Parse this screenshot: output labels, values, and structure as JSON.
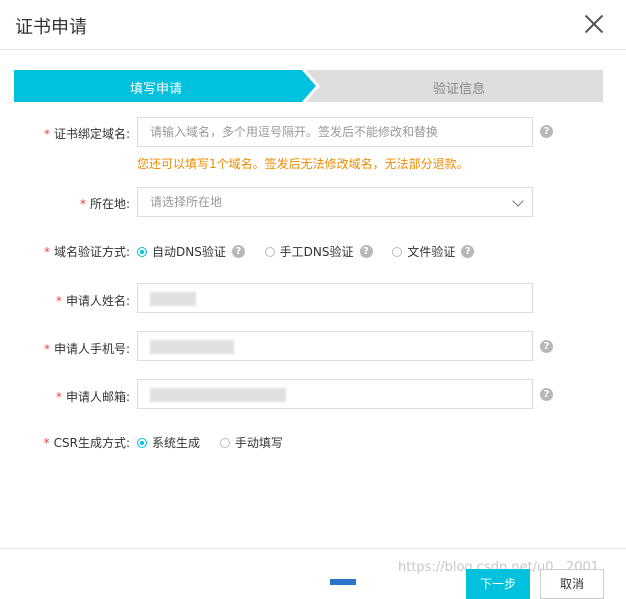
{
  "dialog": {
    "title": "证书申请",
    "close_icon": "close-icon"
  },
  "steps": [
    {
      "label": "填写申请",
      "active": true
    },
    {
      "label": "验证信息",
      "active": false
    }
  ],
  "form": {
    "required_mark": "*",
    "domain": {
      "label": "证书绑定域名:",
      "placeholder": "请输入域名，多个用逗号隔开。签发后不能修改和替换",
      "hint": "您还可以填写1个域名。签发后无法修改域名，无法部分退款。"
    },
    "location": {
      "label": "所在地:",
      "placeholder": "请选择所在地"
    },
    "verify_method": {
      "label": "域名验证方式:",
      "options": [
        {
          "label": "自动DNS验证",
          "checked": true
        },
        {
          "label": "手工DNS验证",
          "checked": false
        },
        {
          "label": "文件验证",
          "checked": false
        }
      ]
    },
    "applicant_name": {
      "label": "申请人姓名:"
    },
    "applicant_phone": {
      "label": "申请人手机号:"
    },
    "applicant_email": {
      "label": "申请人邮箱:"
    },
    "csr": {
      "label": "CSR生成方式:",
      "options": [
        {
          "label": "系统生成",
          "checked": true
        },
        {
          "label": "手动填写",
          "checked": false
        }
      ]
    },
    "help_glyph": "?"
  },
  "footer": {
    "next_label": "下一步",
    "cancel_label": "取消",
    "watermark": "https://blog.csdn.net/u0...2001"
  },
  "colors": {
    "accent": "#00c1de",
    "hint": "#f08c00",
    "required": "#e54545"
  }
}
